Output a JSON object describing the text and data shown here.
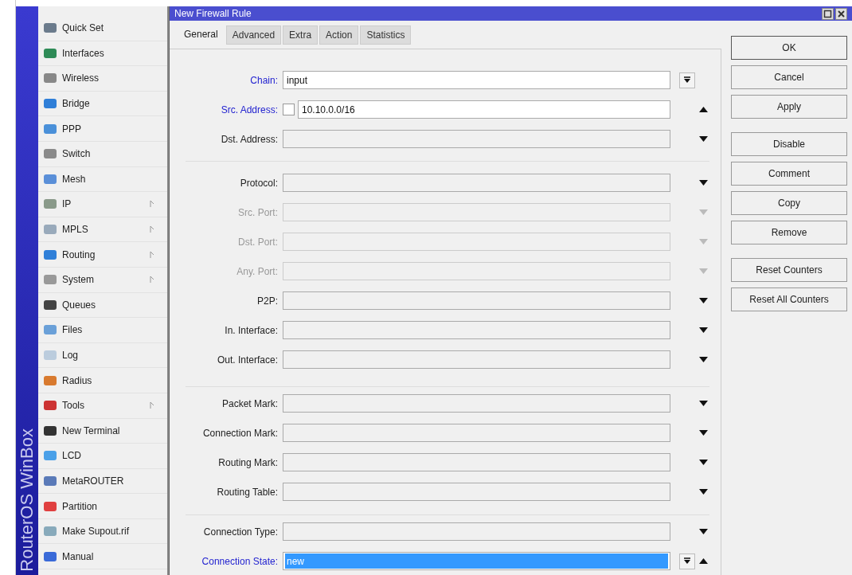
{
  "brand": "RouterOS WinBox",
  "menu": [
    {
      "label": "Quick Set",
      "submenu": false
    },
    {
      "label": "Interfaces",
      "submenu": false
    },
    {
      "label": "Wireless",
      "submenu": false
    },
    {
      "label": "Bridge",
      "submenu": false
    },
    {
      "label": "PPP",
      "submenu": false
    },
    {
      "label": "Switch",
      "submenu": false
    },
    {
      "label": "Mesh",
      "submenu": false
    },
    {
      "label": "IP",
      "submenu": true
    },
    {
      "label": "MPLS",
      "submenu": true
    },
    {
      "label": "Routing",
      "submenu": true
    },
    {
      "label": "System",
      "submenu": true
    },
    {
      "label": "Queues",
      "submenu": false
    },
    {
      "label": "Files",
      "submenu": false
    },
    {
      "label": "Log",
      "submenu": false
    },
    {
      "label": "Radius",
      "submenu": false
    },
    {
      "label": "Tools",
      "submenu": true
    },
    {
      "label": "New Terminal",
      "submenu": false
    },
    {
      "label": "LCD",
      "submenu": false
    },
    {
      "label": "MetaROUTER",
      "submenu": false
    },
    {
      "label": "Partition",
      "submenu": false
    },
    {
      "label": "Make Supout.rif",
      "submenu": false
    },
    {
      "label": "Manual",
      "submenu": false
    }
  ],
  "window": {
    "title": "New Firewall Rule"
  },
  "tabs": [
    {
      "label": "General",
      "selected": true
    },
    {
      "label": "Advanced",
      "selected": false
    },
    {
      "label": "Extra",
      "selected": false
    },
    {
      "label": "Action",
      "selected": false
    },
    {
      "label": "Statistics",
      "selected": false
    }
  ],
  "field_groups": [
    [
      {
        "label": "Chain:",
        "value": "input",
        "set": true,
        "disabled": false,
        "kind": "dropdown"
      },
      {
        "label": "Src. Address:",
        "value": "10.10.0.0/16",
        "set": true,
        "disabled": false,
        "kind": "up",
        "negate_checked": false
      },
      {
        "label": "Dst. Address:",
        "set": false,
        "disabled": false,
        "kind": "down"
      }
    ],
    [
      {
        "label": "Protocol:",
        "set": false,
        "disabled": false,
        "kind": "down"
      },
      {
        "label": "Src. Port:",
        "set": false,
        "disabled": true,
        "kind": "down"
      },
      {
        "label": "Dst. Port:",
        "set": false,
        "disabled": true,
        "kind": "down"
      },
      {
        "label": "Any. Port:",
        "set": false,
        "disabled": true,
        "kind": "down"
      },
      {
        "label": "P2P:",
        "set": false,
        "disabled": false,
        "kind": "down"
      },
      {
        "label": "In. Interface:",
        "set": false,
        "disabled": false,
        "kind": "down"
      },
      {
        "label": "Out. Interface:",
        "set": false,
        "disabled": false,
        "kind": "down"
      }
    ],
    [
      {
        "label": "Packet Mark:",
        "set": false,
        "disabled": false,
        "kind": "down"
      },
      {
        "label": "Connection Mark:",
        "set": false,
        "disabled": false,
        "kind": "down"
      },
      {
        "label": "Routing Mark:",
        "set": false,
        "disabled": false,
        "kind": "down"
      },
      {
        "label": "Routing Table:",
        "set": false,
        "disabled": false,
        "kind": "down"
      }
    ],
    [
      {
        "label": "Connection Type:",
        "set": false,
        "disabled": false,
        "kind": "down"
      },
      {
        "label": "Connection State:",
        "value": "new",
        "set": true,
        "disabled": false,
        "kind": "dropdown-up",
        "selected": true
      }
    ]
  ],
  "button_groups": [
    [
      {
        "label": "OK",
        "default": true
      },
      {
        "label": "Cancel",
        "default": false
      },
      {
        "label": "Apply",
        "default": false
      }
    ],
    [
      {
        "label": "Disable",
        "default": false
      },
      {
        "label": "Comment",
        "default": false
      },
      {
        "label": "Copy",
        "default": false
      },
      {
        "label": "Remove",
        "default": false
      }
    ],
    [
      {
        "label": "Reset Counters",
        "default": false
      },
      {
        "label": "Reset All Counters",
        "default": false
      }
    ]
  ]
}
